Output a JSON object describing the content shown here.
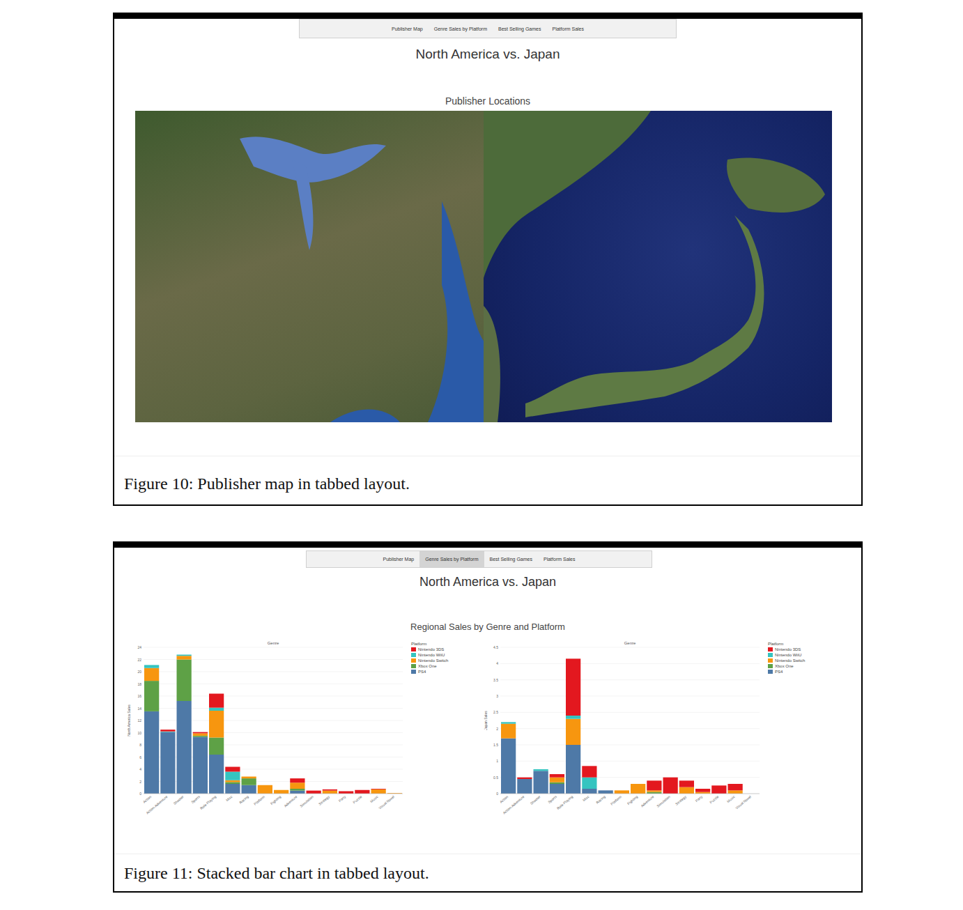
{
  "figures": [
    {
      "dashboard": {
        "tabs": [
          {
            "label": "Publisher Map",
            "selected": false
          },
          {
            "label": "Genre Sales by Platform",
            "selected": false
          },
          {
            "label": "Best Selling Games",
            "selected": false
          },
          {
            "label": "Platform Sales",
            "selected": false
          }
        ],
        "title": "North America vs. Japan",
        "subtitle": "Publisher Locations"
      },
      "caption": "Figure 10: Publisher map in tabbed layout."
    },
    {
      "dashboard": {
        "tabs": [
          {
            "label": "Publisher Map",
            "selected": false
          },
          {
            "label": "Genre Sales by Platform",
            "selected": true
          },
          {
            "label": "Best Selling Games",
            "selected": false
          },
          {
            "label": "Platform Sales",
            "selected": false
          }
        ],
        "title": "North America vs. Japan",
        "subtitle": "Regional Sales by Genre and Platform",
        "charts": [
          {
            "title": "Genre",
            "y_label": "North America Sales",
            "legend_title": "Platform",
            "y_ticks": [
              "0",
              "2",
              "4",
              "6",
              "8",
              "10",
              "12",
              "14",
              "16",
              "18",
              "20",
              "22",
              "24"
            ],
            "categories": [
              "Action",
              "Action-Adventure",
              "Shooter",
              "Sports",
              "Role-Playing",
              "Misc",
              "Racing",
              "Platform",
              "Fighting",
              "Adventure",
              "Simulation",
              "Strategy",
              "Party",
              "Puzzle",
              "Music",
              "Visual Novel"
            ],
            "series": [
              {
                "name": "Nintendo 3DS",
                "color": "#e3181f",
                "values": [
                  0,
                  0.3,
                  0,
                  0.2,
                  2.3,
                  0.8,
                  0,
                  0,
                  0,
                  0.7,
                  0.5,
                  0.2,
                  0.4,
                  0.6,
                  0.1,
                  0
                ]
              },
              {
                "name": "Nintendo WiiU",
                "color": "#35c4c0",
                "values": [
                  0.5,
                  0.1,
                  0.2,
                  0,
                  0.5,
                  1.4,
                  0,
                  0,
                  0,
                  0,
                  0,
                  0,
                  0,
                  0,
                  0,
                  0
                ]
              },
              {
                "name": "Nintendo Switch",
                "color": "#f7960f",
                "values": [
                  2.1,
                  0,
                  0.6,
                  0.4,
                  4.4,
                  0.3,
                  0.3,
                  1.4,
                  0.6,
                  1.0,
                  0,
                  0.5,
                  0,
                  0,
                  0.7,
                  0.1
                ]
              },
              {
                "name": "Xbox One",
                "color": "#5ea146",
                "values": [
                  5.0,
                  0,
                  6.8,
                  0.2,
                  2.8,
                  0.3,
                  1.1,
                  0,
                  0,
                  0.3,
                  0,
                  0,
                  0,
                  0,
                  0,
                  0
                ]
              },
              {
                "name": "PS4",
                "color": "#4e79a7",
                "values": [
                  13.5,
                  10.1,
                  15.2,
                  9.3,
                  6.4,
                  1.6,
                  1.4,
                  0,
                  0,
                  0.5,
                  0,
                  0,
                  0,
                  0,
                  0,
                  0
                ]
              }
            ]
          },
          {
            "title": "Genre",
            "y_label": "Japan Sales",
            "legend_title": "Platform",
            "y_ticks": [
              "0",
              "0.5",
              "1",
              "1.5",
              "2",
              "2.5",
              "3",
              "3.5",
              "4",
              "4.5"
            ],
            "categories": [
              "Action",
              "Action-Adventure",
              "Shooter",
              "Sports",
              "Role-Playing",
              "Misc",
              "Racing",
              "Platform",
              "Fighting",
              "Adventure",
              "Simulation",
              "Strategy",
              "Party",
              "Puzzle",
              "Music",
              "Visual Novel"
            ],
            "series": [
              {
                "name": "Nintendo 3DS",
                "color": "#e3181f",
                "values": [
                  0,
                  0.05,
                  0,
                  0.1,
                  1.75,
                  0.35,
                  0,
                  0,
                  0,
                  0.3,
                  0.5,
                  0.2,
                  0.1,
                  0.25,
                  0.2,
                  0
                ]
              },
              {
                "name": "Nintendo WiiU",
                "color": "#35c4c0",
                "values": [
                  0.05,
                  0,
                  0.05,
                  0,
                  0.1,
                  0.35,
                  0,
                  0,
                  0,
                  0,
                  0,
                  0,
                  0,
                  0,
                  0,
                  0
                ]
              },
              {
                "name": "Nintendo Switch",
                "color": "#f7960f",
                "values": [
                  0.45,
                  0,
                  0,
                  0.15,
                  0.8,
                  0,
                  0,
                  0.1,
                  0.3,
                  0.05,
                  0,
                  0.2,
                  0.05,
                  0,
                  0.1,
                  0
                ]
              },
              {
                "name": "Xbox One",
                "color": "#5ea146",
                "values": [
                  0,
                  0,
                  0,
                  0.05,
                  0,
                  0,
                  0,
                  0,
                  0,
                  0.05,
                  0,
                  0,
                  0,
                  0,
                  0,
                  0
                ]
              },
              {
                "name": "PS4",
                "color": "#4e79a7",
                "values": [
                  1.7,
                  0.45,
                  0.7,
                  0.3,
                  1.5,
                  0.15,
                  0.1,
                  0,
                  0,
                  0,
                  0,
                  0,
                  0,
                  0,
                  0,
                  0
                ]
              }
            ]
          }
        ]
      },
      "caption": "Figure 11: Stacked bar chart in tabbed layout."
    }
  ]
}
